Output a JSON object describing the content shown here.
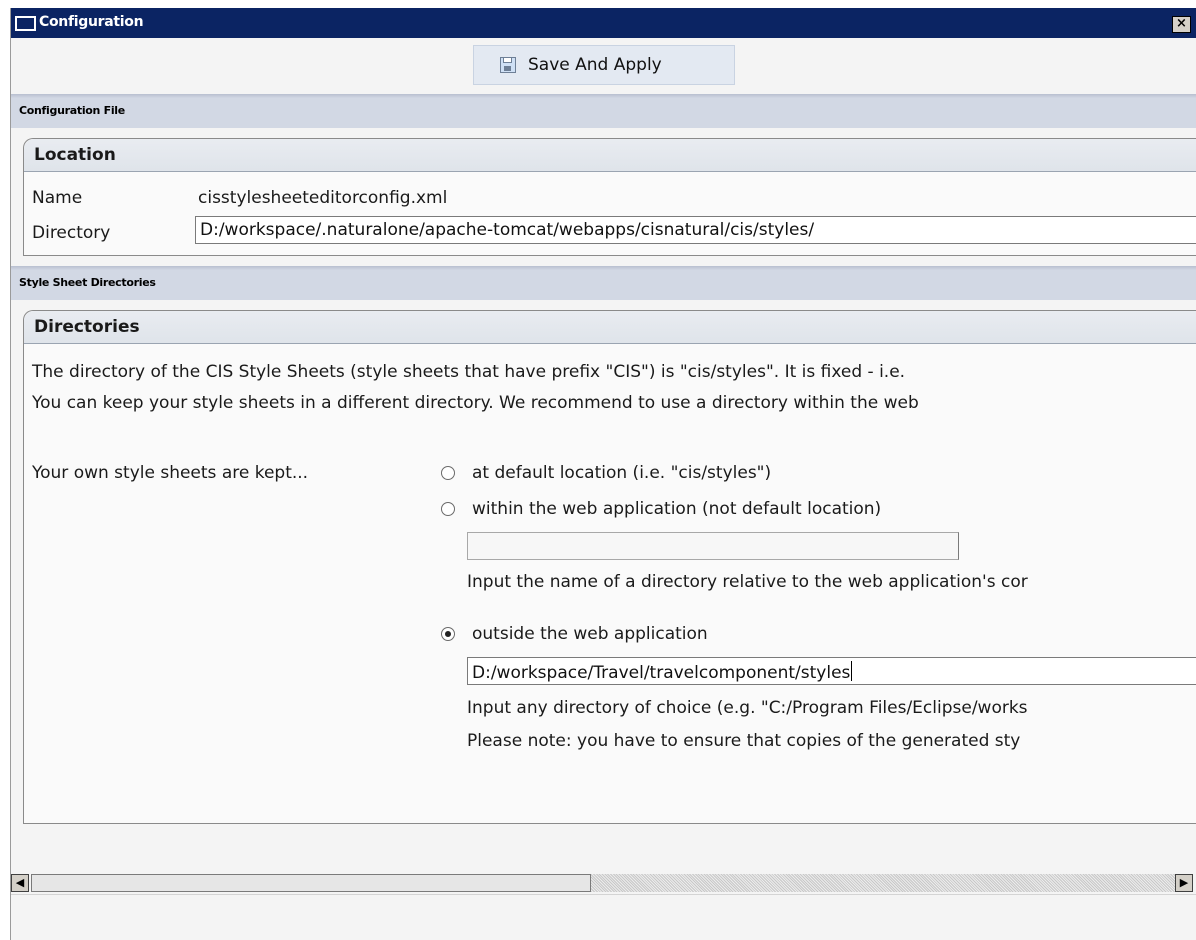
{
  "window": {
    "title": "Configuration",
    "close_label": "×"
  },
  "toolbar": {
    "save_label": "Save And Apply",
    "save_icon": "floppy-disk-icon"
  },
  "config_file": {
    "section_title": "Configuration File",
    "group_title": "Location",
    "name_label": "Name",
    "name_value": "cisstylesheeteditorconfig.xml",
    "directory_label": "Directory",
    "directory_value": "D:/workspace/.naturalone/apache-tomcat/webapps/cisnatural/cis/styles/"
  },
  "style_dirs": {
    "section_title": "Style Sheet Directories",
    "group_title": "Directories",
    "description_line1": "The directory of the CIS Style Sheets (style sheets that have prefix \"CIS\") is \"cis/styles\". It is fixed - i.e.",
    "description_line2": "You can keep your style sheets in a different directory. We recommend to use a directory within the web",
    "kept_label": "Your own style sheets are kept...",
    "options": [
      {
        "label": "at  default location (i.e. \"cis/styles\")",
        "checked": false
      },
      {
        "label": "within the web application (not default location)",
        "checked": false,
        "input_value": "",
        "hint": "Input the name of a directory relative to the web application's cor"
      },
      {
        "label": "outside the web application",
        "checked": true,
        "input_value": "D:/workspace/Travel/travelcomponent/styles",
        "hint": "Input any directory of choice (e.g. \"C:/Program Files/Eclipse/works",
        "note": "Please note: you have to ensure that copies of the generated sty"
      }
    ]
  }
}
